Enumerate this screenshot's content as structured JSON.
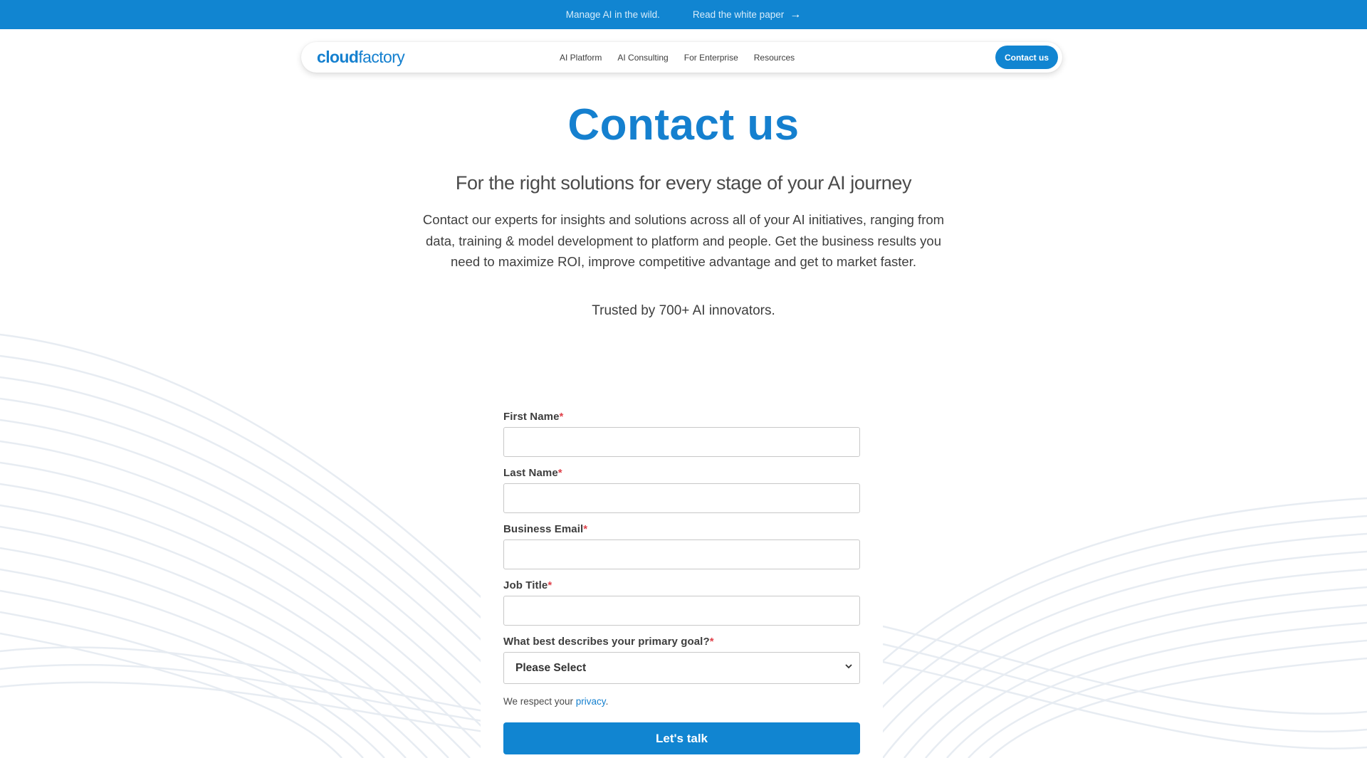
{
  "colors": {
    "primary": "#1185d1",
    "heading": "#1580cf",
    "required": "#e0424b"
  },
  "announcement": {
    "text": "Manage AI in the wild.",
    "link_label": "Read the white paper",
    "link_icon": "arrow-right-icon"
  },
  "nav": {
    "logo_bold": "cloud",
    "logo_regular": "factory",
    "links": [
      "AI Platform",
      "AI Consulting",
      "For Enterprise",
      "Resources"
    ],
    "cta_label": "Contact us"
  },
  "hero": {
    "title": "Contact us",
    "subtitle": "For the right solutions for every stage of your AI journey",
    "description": "Contact our experts for insights and solutions across all of your AI initiatives, ranging from data, training & model development to platform and people. Get the business results you need to maximize ROI, improve competitive advantage and get to market faster.",
    "trusted": "Trusted by 700+ AI innovators."
  },
  "form": {
    "required_mark": "*",
    "fields": [
      {
        "label": "First Name",
        "value": ""
      },
      {
        "label": "Last Name",
        "value": ""
      },
      {
        "label": "Business Email",
        "value": ""
      },
      {
        "label": "Job Title",
        "value": ""
      }
    ],
    "goal": {
      "label": "What best describes your primary goal?",
      "selected": "Please Select",
      "icon": "chevron-down-icon"
    },
    "privacy_prefix": "We respect your ",
    "privacy_link": "privacy",
    "privacy_suffix": ".",
    "submit_label": "Let's talk"
  }
}
